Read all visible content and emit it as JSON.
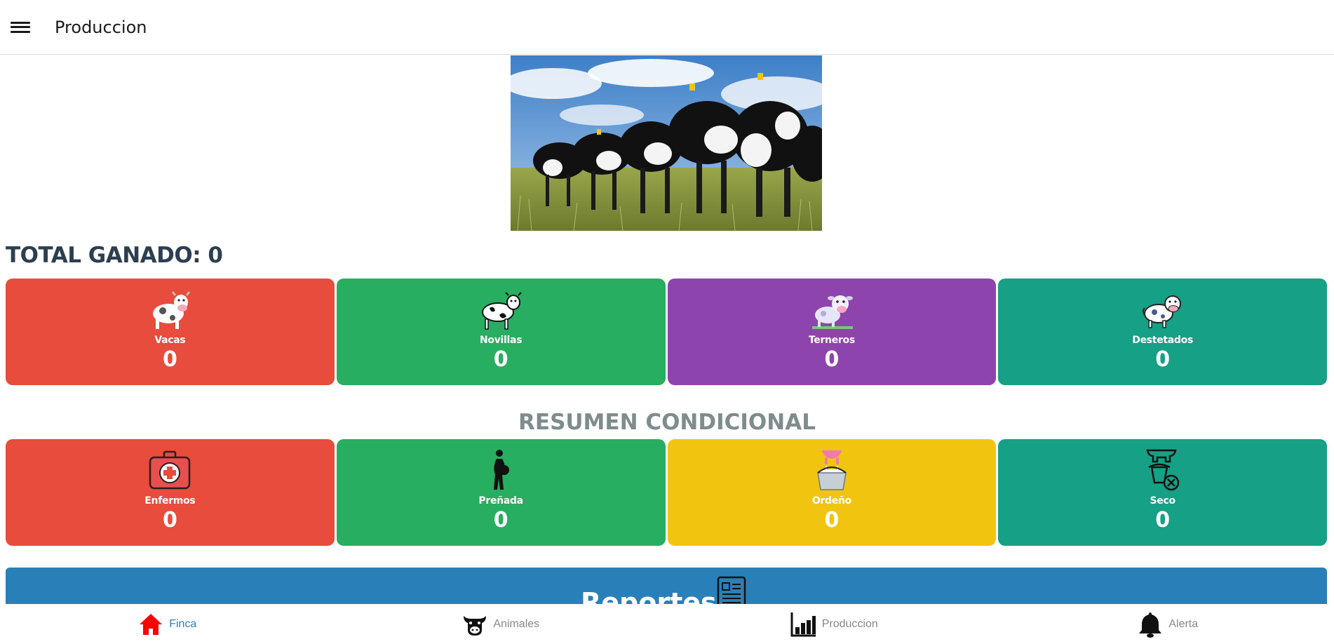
{
  "header": {
    "title": "Produccion",
    "menu_icon": "menu-icon"
  },
  "hero": {
    "alt": "Vacas en el campo"
  },
  "summary": {
    "total_label": "TOTAL GANADO: 0",
    "cards": [
      {
        "label": "Vacas",
        "value": "0",
        "color": "#e74c3c",
        "icon": "cow-icon"
      },
      {
        "label": "Novillas",
        "value": "0",
        "color": "#27ae60",
        "icon": "heifer-icon"
      },
      {
        "label": "Terneros",
        "value": "0",
        "color": "#8e44ad",
        "icon": "calf-icon"
      },
      {
        "label": "Destetados",
        "value": "0",
        "color": "#16a085",
        "icon": "weaned-icon"
      }
    ]
  },
  "conditional": {
    "title": "RESUMEN CONDICIONAL",
    "cards": [
      {
        "label": "Enfermos",
        "value": "0",
        "color": "#e74c3c",
        "icon": "first-aid-kit-icon"
      },
      {
        "label": "Preñada",
        "value": "0",
        "color": "#27ae60",
        "icon": "pregnant-icon"
      },
      {
        "label": "Ordeño",
        "value": "0",
        "color": "#f1c40f",
        "icon": "milk-bucket-icon"
      },
      {
        "label": "Seco",
        "value": "0",
        "color": "#16a085",
        "icon": "dry-udder-icon"
      }
    ]
  },
  "reports": {
    "label": "Reportes",
    "icon": "report-icon",
    "color": "#2980b9"
  },
  "bottom_nav": [
    {
      "label": "Finca",
      "icon": "home-icon",
      "active": true
    },
    {
      "label": "Animales",
      "icon": "cow-head-icon",
      "active": false
    },
    {
      "label": "Produccion",
      "icon": "bar-chart-icon",
      "active": false
    },
    {
      "label": "Alerta",
      "icon": "bell-icon",
      "active": false
    }
  ]
}
